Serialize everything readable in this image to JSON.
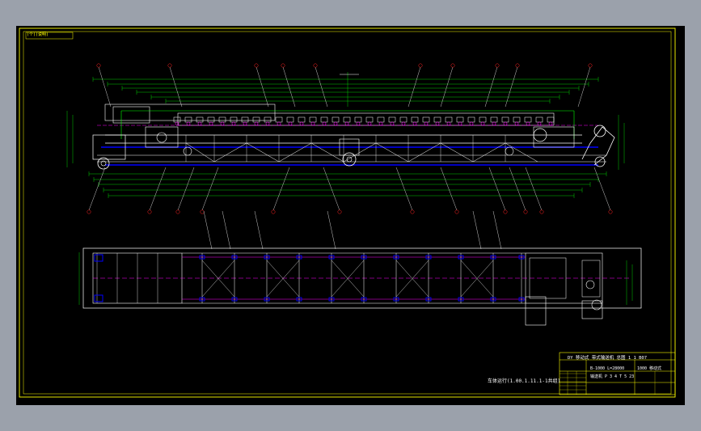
{
  "viewport": {
    "background": "#9ba1ab",
    "canvas_background": "#000000"
  },
  "colors": {
    "frame": "#ffff00",
    "outline": "#ffffff",
    "structure": "#00ff00",
    "centerline": "#ff00ff",
    "dimension": "#00ff00",
    "belt": "#0000ff",
    "cyan": "#00ffff",
    "red": "#ff2020"
  },
  "drawing": {
    "corner_tag": "(个)(说明)",
    "note_text": "车体运行(1.00.1.11.1-1共组)",
    "title_block": {
      "header": "DY 移动式 带式输送机 总图 1 1 B07",
      "code_a": "B-1000 L=28000",
      "code_b": "1000 移动式",
      "code_c": "输送机 P 3 4 T 5 23"
    }
  }
}
